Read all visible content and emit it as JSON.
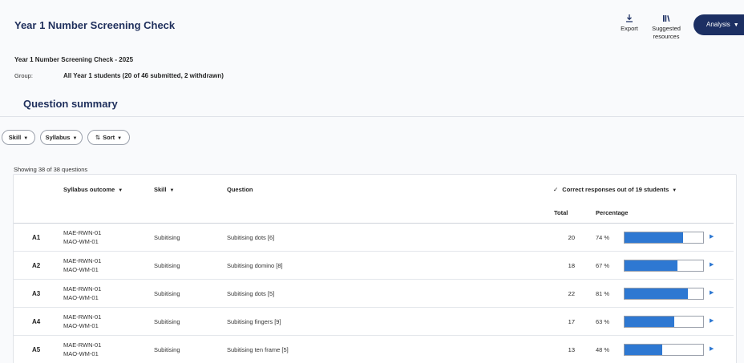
{
  "header": {
    "title": "Year 1 Number Screening Check",
    "export_label": "Export",
    "resources_label_line1": "Suggested",
    "resources_label_line2": "resources",
    "analysis_label": "Analysis"
  },
  "report": {
    "title": "Year 1 Number Screening Check - 2025",
    "group_label": "Group:",
    "group_value": "All Year 1 students (20 of 46 submitted, 2 withdrawn)"
  },
  "section": {
    "title": "Question summary"
  },
  "filters": {
    "skill": "Skill",
    "syllabus": "Syllabus",
    "sort": "Sort"
  },
  "showing": "Showing 38 of 38 questions",
  "table": {
    "headers": {
      "syllabus": "Syllabus outcome",
      "skill": "Skill",
      "question": "Question",
      "correct": "Correct responses out of 19 students",
      "total": "Total",
      "percentage": "Percentage"
    },
    "rows": [
      {
        "id": "A1",
        "syllabus1": "MAE-RWN-01",
        "syllabus2": "MAO-WM-01",
        "skill": "Subitising",
        "question": "Subitising dots [6]",
        "total": "20",
        "pct_text": "74 %",
        "pct": 74
      },
      {
        "id": "A2",
        "syllabus1": "MAE-RWN-01",
        "syllabus2": "MAO-WM-01",
        "skill": "Subitising",
        "question": "Subitising domino [8]",
        "total": "18",
        "pct_text": "67 %",
        "pct": 67
      },
      {
        "id": "A3",
        "syllabus1": "MAE-RWN-01",
        "syllabus2": "MAO-WM-01",
        "skill": "Subitising",
        "question": "Subitising dots [5]",
        "total": "22",
        "pct_text": "81 %",
        "pct": 81
      },
      {
        "id": "A4",
        "syllabus1": "MAE-RWN-01",
        "syllabus2": "MAO-WM-01",
        "skill": "Subitising",
        "question": "Subitising fingers [9]",
        "total": "17",
        "pct_text": "63 %",
        "pct": 63
      },
      {
        "id": "A5",
        "syllabus1": "MAE-RWN-01",
        "syllabus2": "MAO-WM-01",
        "skill": "Subitising",
        "question": "Subitising ten frame [5]",
        "total": "13",
        "pct_text": "48 %",
        "pct": 48
      }
    ]
  },
  "colors": {
    "accent": "#1c2f63",
    "bar": "#2e78d2"
  }
}
